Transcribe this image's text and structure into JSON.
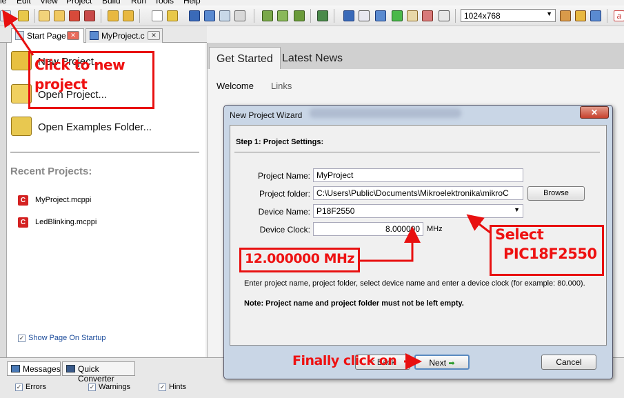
{
  "menu": [
    "le",
    "Edit",
    "View",
    "Project",
    "Build",
    "Run",
    "Tools",
    "Help"
  ],
  "toolbar": {
    "resolution": "1024x768"
  },
  "tabs": [
    {
      "label": "Start Page"
    },
    {
      "label": "MyProject.c"
    }
  ],
  "start_page": {
    "actions": [
      "New Project...",
      "Open Project...",
      "Open Examples Folder..."
    ],
    "recent_title": "Recent Projects:",
    "recent": [
      "MyProject.mcppi",
      "LedBlinking.mcppi"
    ],
    "show_on_startup": "Show Page On Startup",
    "right_tabs": [
      "Get Started",
      "Latest News"
    ],
    "right_subtabs": [
      "Welcome",
      "Links"
    ]
  },
  "bottom": {
    "tabs": [
      "Messages",
      "Quick Converter"
    ],
    "filters": [
      "Errors",
      "Warnings",
      "Hints"
    ]
  },
  "dialog": {
    "title": "New Project Wizard",
    "close": "✕",
    "step_title": "Step 1: Project Settings:",
    "fields": {
      "name_label": "Project Name:",
      "name_value": "MyProject",
      "folder_label": "Project folder:",
      "folder_value": "C:\\Users\\Public\\Documents\\Mikroelektronika\\mikroC",
      "device_label": "Device Name:",
      "device_value": "P18F2550",
      "clock_label": "Device Clock:",
      "clock_value": "8.000000",
      "clock_unit": "MHz"
    },
    "browse": "Browse",
    "info": "Enter project name, project folder, select device name and enter a device clock (for example: 80.000).",
    "note": "Note: Project name and project folder must not be left empty.",
    "back": "< Back",
    "next": "Next",
    "cancel": "Cancel"
  },
  "annotations": {
    "new_project_1": "Click to new",
    "new_project_2": "project",
    "select_1": "Select",
    "select_2": "PIC18F2550",
    "clock": "12.000000 MHz",
    "finally": "Finally click on"
  },
  "colors": {
    "annotation": "#e81010",
    "dialog_frame": "#c9d6e6"
  }
}
